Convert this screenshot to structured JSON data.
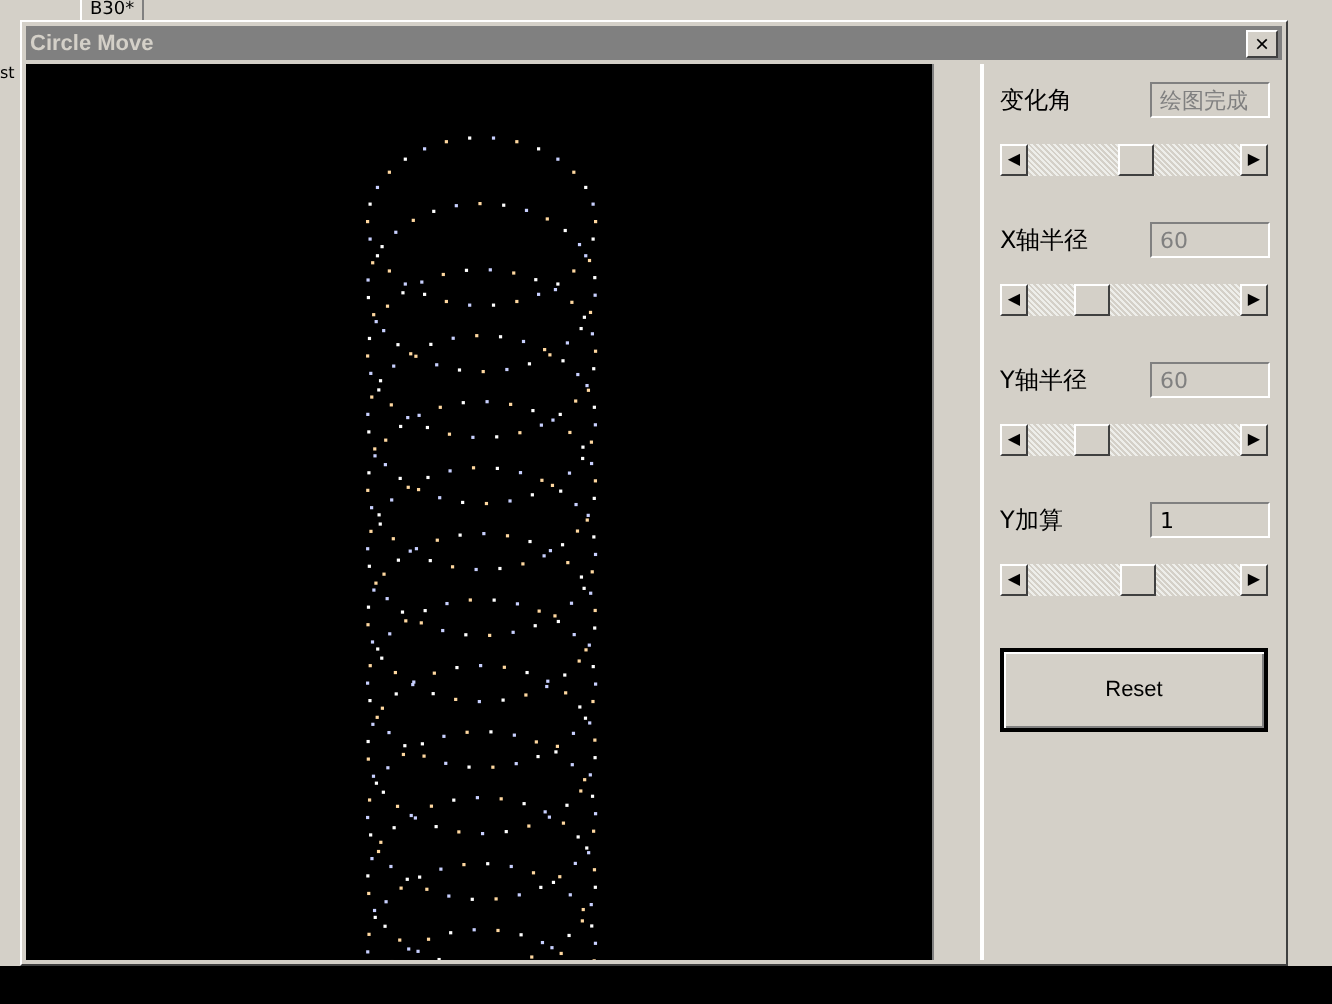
{
  "background": {
    "tab_label": "B30*",
    "edge_text": "st"
  },
  "window": {
    "title": "Circle Move",
    "close": "×"
  },
  "controls": [
    {
      "label": "变化角",
      "value": "绘图完成",
      "disabled": true,
      "level": 0.52
    },
    {
      "label": "X轴半径",
      "value": "60",
      "disabled": true,
      "level": 0.27
    },
    {
      "label": "Y轴半径",
      "value": "60",
      "disabled": true,
      "level": 0.27
    },
    {
      "label": "Y加算",
      "value": "1",
      "disabled": false,
      "level": 0.53
    }
  ],
  "arrows": {
    "left": "◀",
    "right": "▶"
  },
  "buttons": [
    {
      "label": "Reset"
    }
  ]
}
